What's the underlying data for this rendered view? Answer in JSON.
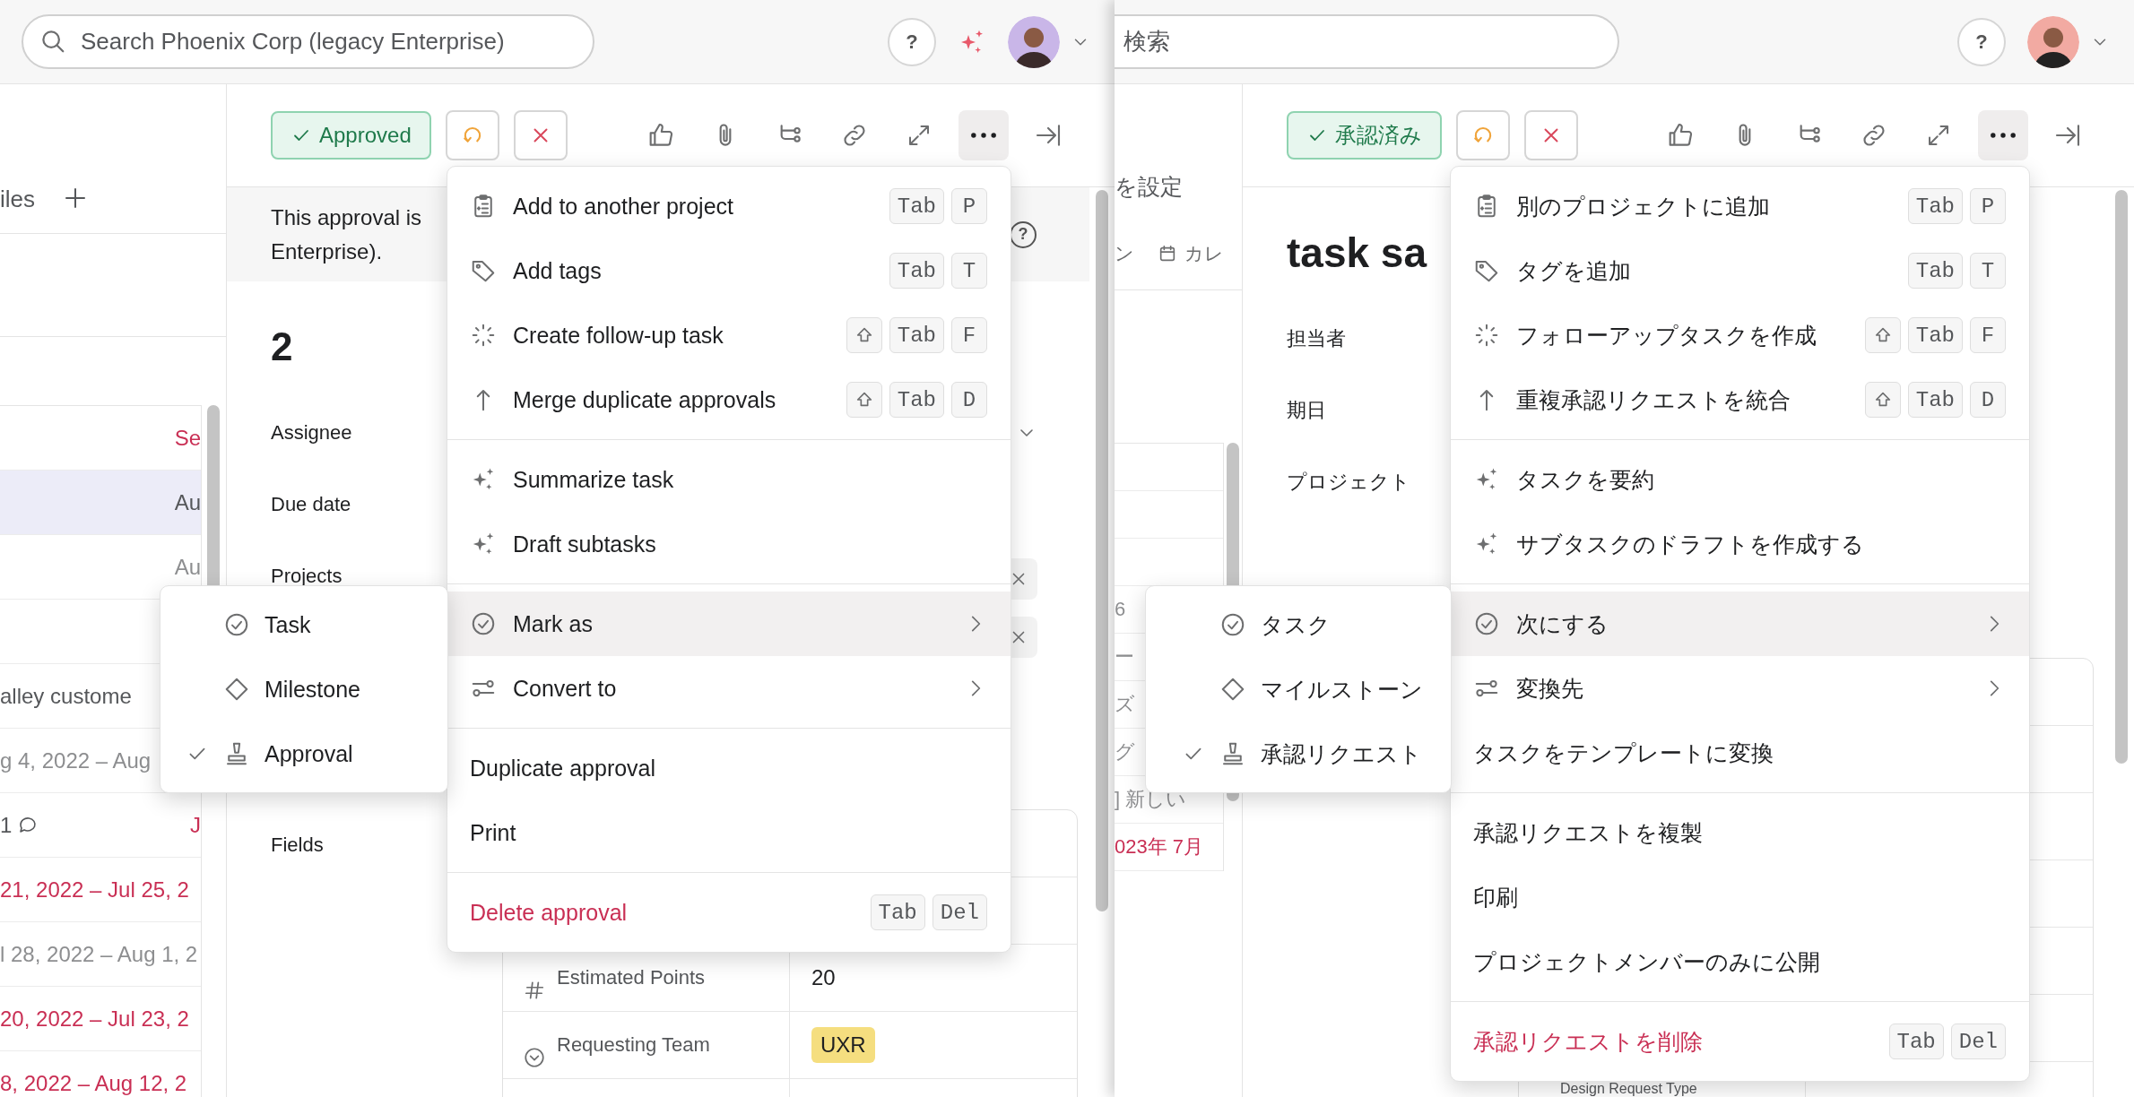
{
  "panes": [
    {
      "topbar": {
        "search": {
          "placeholder": "Search Phoenix Corp (legacy Enterprise)"
        },
        "actions": [
          {
            "kind": "help",
            "text": "?"
          },
          {
            "kind": "ai"
          },
          {
            "kind": "avatar"
          }
        ]
      },
      "sidebar": {
        "kind": "files",
        "header": "iles",
        "rows": [
          {
            "kind": "due",
            "text": "Se",
            "overdue": true,
            "muted": false,
            "selected": false
          },
          {
            "kind": "due",
            "text": "Au",
            "overdue": false,
            "muted": false,
            "selected": true
          },
          {
            "kind": "due",
            "text": "Au",
            "overdue": false,
            "muted": true,
            "selected": false
          },
          {
            "kind": "blank",
            "selected": false
          },
          {
            "kind": "title",
            "text": "alley custome",
            "overdue": false,
            "muted": false,
            "selected": false
          },
          {
            "kind": "date",
            "text": "g 4, 2022 – Aug",
            "overdue": false,
            "muted": true,
            "selected": false
          },
          {
            "kind": "comments",
            "text": "1",
            "due": "J",
            "overdue": true,
            "muted": false,
            "selected": false
          },
          {
            "kind": "date",
            "text": "21, 2022 – Jul 25, 2",
            "overdue": true,
            "muted": false,
            "selected": false
          },
          {
            "kind": "date",
            "text": "l 28, 2022 – Aug 1, 2",
            "overdue": false,
            "muted": true,
            "selected": false
          },
          {
            "kind": "date",
            "text": "20, 2022 – Jul 23, 2",
            "overdue": true,
            "muted": false,
            "selected": false
          },
          {
            "kind": "date",
            "text": "8, 2022 – Aug 12, 2",
            "overdue": true,
            "muted": false,
            "selected": false
          }
        ]
      },
      "detail": {
        "toolbar": {
          "status_button": "Approved",
          "more_active": true
        },
        "banner": {
          "lines": [
            "This approval is",
            "Enterprise)."
          ],
          "help": "?"
        },
        "title": "2",
        "fields": [
          {
            "label": "Assignee",
            "kind": "select"
          },
          {
            "label": "Due date",
            "kind": "empty"
          },
          {
            "label": "Projects",
            "kind": "chips",
            "chips": [
              {
                "kind": "project"
              },
              {
                "kind": "project"
              }
            ]
          },
          {
            "label": "Fields",
            "kind": "table",
            "rows": [
              {
                "kind": "blank"
              },
              {
                "kind": "blank"
              },
              {
                "kind": "number",
                "name": "Estimated Points",
                "value": "20"
              },
              {
                "kind": "select",
                "name": "Requesting Team",
                "value": "UXR",
                "color": "#f5de7f"
              },
              {
                "kind": "blank"
              }
            ]
          }
        ]
      },
      "menu": {
        "sections": [
          [
            {
              "kind": "action",
              "label": "Add to another project",
              "keys": [
                "Tab",
                "P"
              ],
              "shift": false,
              "selected": false
            },
            {
              "kind": "action",
              "label": "Add tags",
              "keys": [
                "Tab",
                "T"
              ],
              "shift": false,
              "selected": false
            },
            {
              "kind": "action",
              "label": "Create follow-up task",
              "keys": [
                "Tab",
                "F"
              ],
              "shift": true,
              "selected": false
            },
            {
              "kind": "action",
              "label": "Merge duplicate approvals",
              "keys": [
                "Tab",
                "D"
              ],
              "shift": true,
              "selected": false
            }
          ],
          [
            {
              "kind": "action",
              "label": "Summarize task",
              "selected": false
            },
            {
              "kind": "action",
              "label": "Draft subtasks",
              "selected": false
            }
          ],
          [
            {
              "kind": "submenu",
              "label": "Mark as",
              "selected": true
            },
            {
              "kind": "submenu",
              "label": "Convert to",
              "selected": false
            }
          ],
          [
            {
              "kind": "plain",
              "label": "Duplicate approval",
              "selected": false
            },
            {
              "kind": "plain",
              "label": "Print",
              "selected": false
            }
          ],
          [
            {
              "kind": "danger",
              "label": "Delete approval",
              "keys": [
                "Tab",
                "Del"
              ],
              "shift": false,
              "selected": false
            }
          ]
        ]
      },
      "submenu": {
        "items": [
          {
            "label": "Task",
            "checked": false
          },
          {
            "label": "Milestone",
            "checked": false
          },
          {
            "label": "Approval",
            "checked": true
          }
        ]
      }
    },
    {
      "topbar": {
        "search": {
          "placeholder": "検索"
        },
        "actions": [
          {
            "kind": "help",
            "text": "?"
          },
          {
            "kind": "avatar"
          }
        ]
      },
      "sidebar": {
        "kind": "tabs",
        "header": "を設定",
        "tabs": [
          {
            "text": "ン",
            "kind": "plain"
          },
          {
            "text": "カレ",
            "kind": "calendar"
          }
        ],
        "rows": [
          {
            "kind": "blank",
            "selected": false
          },
          {
            "kind": "blank",
            "selected": false
          },
          {
            "kind": "blank",
            "selected": false
          },
          {
            "kind": "date",
            "text": "6",
            "overdue": false,
            "muted": true,
            "selected": false
          },
          {
            "kind": "date",
            "text": "ー",
            "overdue": false,
            "muted": true,
            "selected": false
          },
          {
            "kind": "title",
            "text": "ズ",
            "overdue": false,
            "muted": true,
            "selected": false
          },
          {
            "kind": "title",
            "text": "グ",
            "overdue": false,
            "muted": true,
            "selected": false
          },
          {
            "kind": "title",
            "text": "] 新しい",
            "overdue": false,
            "muted": true,
            "selected": false
          },
          {
            "kind": "date",
            "text": "023年 7月",
            "overdue": true,
            "muted": false,
            "selected": false
          }
        ]
      },
      "detail": {
        "toolbar": {
          "status_button": "承認済み",
          "more_active": true
        },
        "title": "task sa",
        "fields": [
          {
            "label": "担当者",
            "kind": "empty"
          },
          {
            "label": "期日",
            "kind": "empty"
          },
          {
            "label": "プロジェクト",
            "kind": "empty"
          },
          {
            "kind": "table",
            "rows": [
              {
                "kind": "blank"
              },
              {
                "kind": "blank"
              },
              {
                "kind": "blank"
              },
              {
                "kind": "blank"
              },
              {
                "kind": "blank"
              },
              {
                "kind": "blank"
              },
              {
                "kind": "checkbox",
                "name": "Design Request Type"
              }
            ]
          }
        ]
      },
      "menu": {
        "sections": [
          [
            {
              "kind": "action",
              "label": "別のプロジェクトに追加",
              "keys": [
                "Tab",
                "P"
              ],
              "shift": false,
              "selected": false
            },
            {
              "kind": "action",
              "label": "タグを追加",
              "keys": [
                "Tab",
                "T"
              ],
              "shift": false,
              "selected": false
            },
            {
              "kind": "action",
              "label": "フォローアップタスクを作成",
              "keys": [
                "Tab",
                "F"
              ],
              "shift": true,
              "selected": false
            },
            {
              "kind": "action",
              "label": "重複承認リクエストを統合",
              "keys": [
                "Tab",
                "D"
              ],
              "shift": true,
              "selected": false
            }
          ],
          [
            {
              "kind": "action",
              "label": "タスクを要約",
              "selected": false
            },
            {
              "kind": "action",
              "label": "サブタスクのドラフトを作成する",
              "selected": false
            }
          ],
          [
            {
              "kind": "submenu",
              "label": "次にする",
              "selected": true
            },
            {
              "kind": "submenu",
              "label": "変換先",
              "selected": false
            },
            {
              "kind": "plain",
              "label": "タスクをテンプレートに変換",
              "selected": false
            }
          ],
          [
            {
              "kind": "plain",
              "label": "承認リクエストを複製",
              "selected": false
            },
            {
              "kind": "plain",
              "label": "印刷",
              "selected": false
            },
            {
              "kind": "plain",
              "label": "プロジェクトメンバーのみに公開",
              "selected": false
            }
          ],
          [
            {
              "kind": "danger",
              "label": "承認リクエストを削除",
              "keys": [
                "Tab",
                "Del"
              ],
              "shift": false,
              "selected": false
            }
          ]
        ]
      },
      "submenu": {
        "items": [
          {
            "label": "タスク",
            "checked": false
          },
          {
            "label": "マイルストーン",
            "checked": false
          },
          {
            "label": "承認リクエスト",
            "checked": true
          }
        ]
      }
    }
  ]
}
